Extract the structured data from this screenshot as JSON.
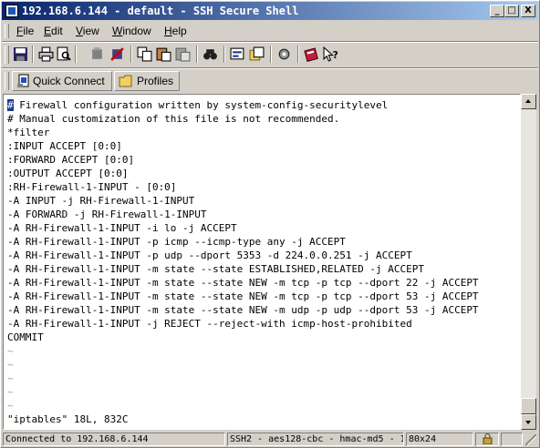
{
  "window": {
    "title": "192.168.6.144 - default - SSH Secure Shell",
    "minimize_glyph": "_",
    "maximize_glyph": "□",
    "close_glyph": "X"
  },
  "menu": [
    "File",
    "Edit",
    "View",
    "Window",
    "Help"
  ],
  "toolbar_icons": [
    "save-icon",
    "print-icon",
    "print-preview-icon",
    "connect-icon",
    "disconnect-icon",
    "copy-icon",
    "paste-icon",
    "paste-selection-icon",
    "find-icon",
    "new-terminal-icon",
    "new-file-transfer-icon",
    "settings-icon",
    "help-book-icon",
    "context-help-icon"
  ],
  "quickbar": {
    "quick_connect": "Quick Connect",
    "profiles": "Profiles"
  },
  "terminal": {
    "cursor_char": "#",
    "first_line_rest": " Firewall configuration written by system-config-securitylevel",
    "lines": [
      "# Manual customization of this file is not recommended.",
      "*filter",
      ":INPUT ACCEPT [0:0]",
      ":FORWARD ACCEPT [0:0]",
      ":OUTPUT ACCEPT [0:0]",
      ":RH-Firewall-1-INPUT - [0:0]",
      "-A INPUT -j RH-Firewall-1-INPUT",
      "-A FORWARD -j RH-Firewall-1-INPUT",
      "-A RH-Firewall-1-INPUT -i lo -j ACCEPT",
      "-A RH-Firewall-1-INPUT -p icmp --icmp-type any -j ACCEPT",
      "-A RH-Firewall-1-INPUT -p udp --dport 5353 -d 224.0.0.251 -j ACCEPT",
      "-A RH-Firewall-1-INPUT -m state --state ESTABLISHED,RELATED -j ACCEPT",
      "-A RH-Firewall-1-INPUT -m state --state NEW -m tcp -p tcp --dport 22 -j ACCEPT",
      "-A RH-Firewall-1-INPUT -m state --state NEW -m tcp -p tcp --dport 53 -j ACCEPT",
      "-A RH-Firewall-1-INPUT -m state --state NEW -m udp -p udp --dport 53 -j ACCEPT",
      "-A RH-Firewall-1-INPUT -j REJECT --reject-with icmp-host-prohibited",
      "COMMIT"
    ],
    "tildes": [
      "~",
      "~",
      "~",
      "~",
      "~"
    ],
    "status_line": "\"iptables\" 18L, 832C"
  },
  "statusbar": {
    "connection": "Connected to 192.168.6.144",
    "cipher": "SSH2 - aes128-cbc - hmac-md5 - 1",
    "size": "80x24"
  },
  "colors": {
    "title_start": "#08246b",
    "title_end": "#a6caf0",
    "chrome": "#d4d0c8",
    "cursor_bg": "#1b3a8a"
  }
}
